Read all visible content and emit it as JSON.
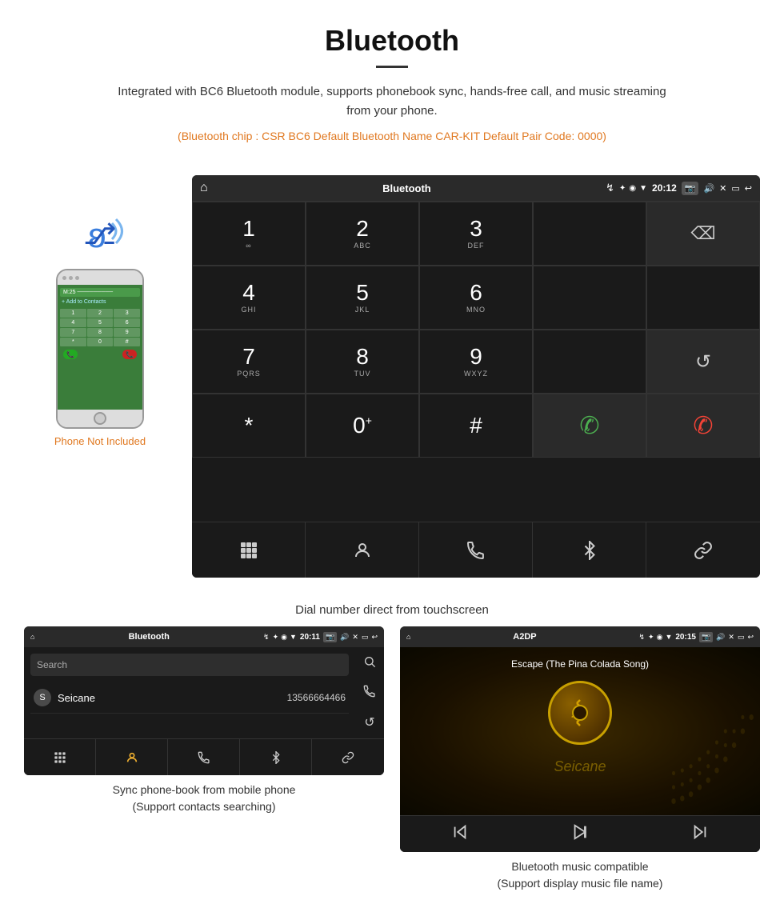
{
  "header": {
    "title": "Bluetooth",
    "description": "Integrated with BC6 Bluetooth module, supports phonebook sync, hands-free call, and music streaming from your phone.",
    "specs": "(Bluetooth chip : CSR BC6    Default Bluetooth Name CAR-KIT    Default Pair Code: 0000)"
  },
  "phone_note": "Phone Not Included",
  "dial_screen": {
    "status_bar": {
      "home": "⌂",
      "title": "Bluetooth",
      "usb": "↯",
      "bt": "✦",
      "location": "◉",
      "signal": "▼",
      "time": "20:12",
      "camera": "📷",
      "volume": "🔊",
      "close": "✕",
      "window": "▭",
      "back": "↩"
    },
    "keys": [
      {
        "num": "1",
        "sub": "∞"
      },
      {
        "num": "2",
        "sub": "ABC"
      },
      {
        "num": "3",
        "sub": "DEF"
      },
      {
        "num": "",
        "sub": ""
      },
      {
        "num": "⌫",
        "sub": ""
      },
      {
        "num": "4",
        "sub": "GHI"
      },
      {
        "num": "5",
        "sub": "JKL"
      },
      {
        "num": "6",
        "sub": "MNO"
      },
      {
        "num": "",
        "sub": ""
      },
      {
        "num": "",
        "sub": ""
      },
      {
        "num": "7",
        "sub": "PQRS"
      },
      {
        "num": "8",
        "sub": "TUV"
      },
      {
        "num": "9",
        "sub": "WXYZ"
      },
      {
        "num": "",
        "sub": ""
      },
      {
        "num": "↺",
        "sub": ""
      },
      {
        "num": "*",
        "sub": ""
      },
      {
        "num": "0",
        "sub": "+"
      },
      {
        "num": "#",
        "sub": ""
      },
      {
        "num": "📞green",
        "sub": ""
      },
      {
        "num": "📞red",
        "sub": ""
      }
    ],
    "action_bar": [
      "⊞",
      "👤",
      "📞",
      "✦",
      "🔗"
    ]
  },
  "dial_caption": "Dial number direct from touchscreen",
  "phonebook_screen": {
    "status_bar": {
      "home": "⌂",
      "title": "Bluetooth",
      "usb": "↯",
      "bt": "✦",
      "location": "◉",
      "signal": "▼",
      "time": "20:11",
      "camera": "📷",
      "volume": "🔊",
      "close": "✕",
      "window": "▭",
      "back": "↩"
    },
    "search_placeholder": "Search",
    "contact": {
      "letter": "S",
      "name": "Seicane",
      "phone": "13566664466"
    },
    "sidebar_icons": [
      "🔍",
      "📞",
      "↺"
    ],
    "action_bar": [
      "⊞",
      "👤yellow",
      "📞",
      "✦",
      "🔗"
    ]
  },
  "phonebook_caption_line1": "Sync phone-book from mobile phone",
  "phonebook_caption_line2": "(Support contacts searching)",
  "a2dp_screen": {
    "status_bar": {
      "home": "⌂",
      "title": "A2DP",
      "usb": "↯",
      "bt": "✦",
      "location": "◉",
      "signal": "▼",
      "time": "20:15",
      "camera": "📷",
      "volume": "🔊",
      "close": "✕",
      "window": "▭",
      "back": "↩"
    },
    "song_title": "Escape (The Pina Colada Song)",
    "controls": [
      "⏮",
      "⏭▐",
      "⏭"
    ]
  },
  "a2dp_caption_line1": "Bluetooth music compatible",
  "a2dp_caption_line2": "(Support display music file name)",
  "watermark": "Seicane"
}
